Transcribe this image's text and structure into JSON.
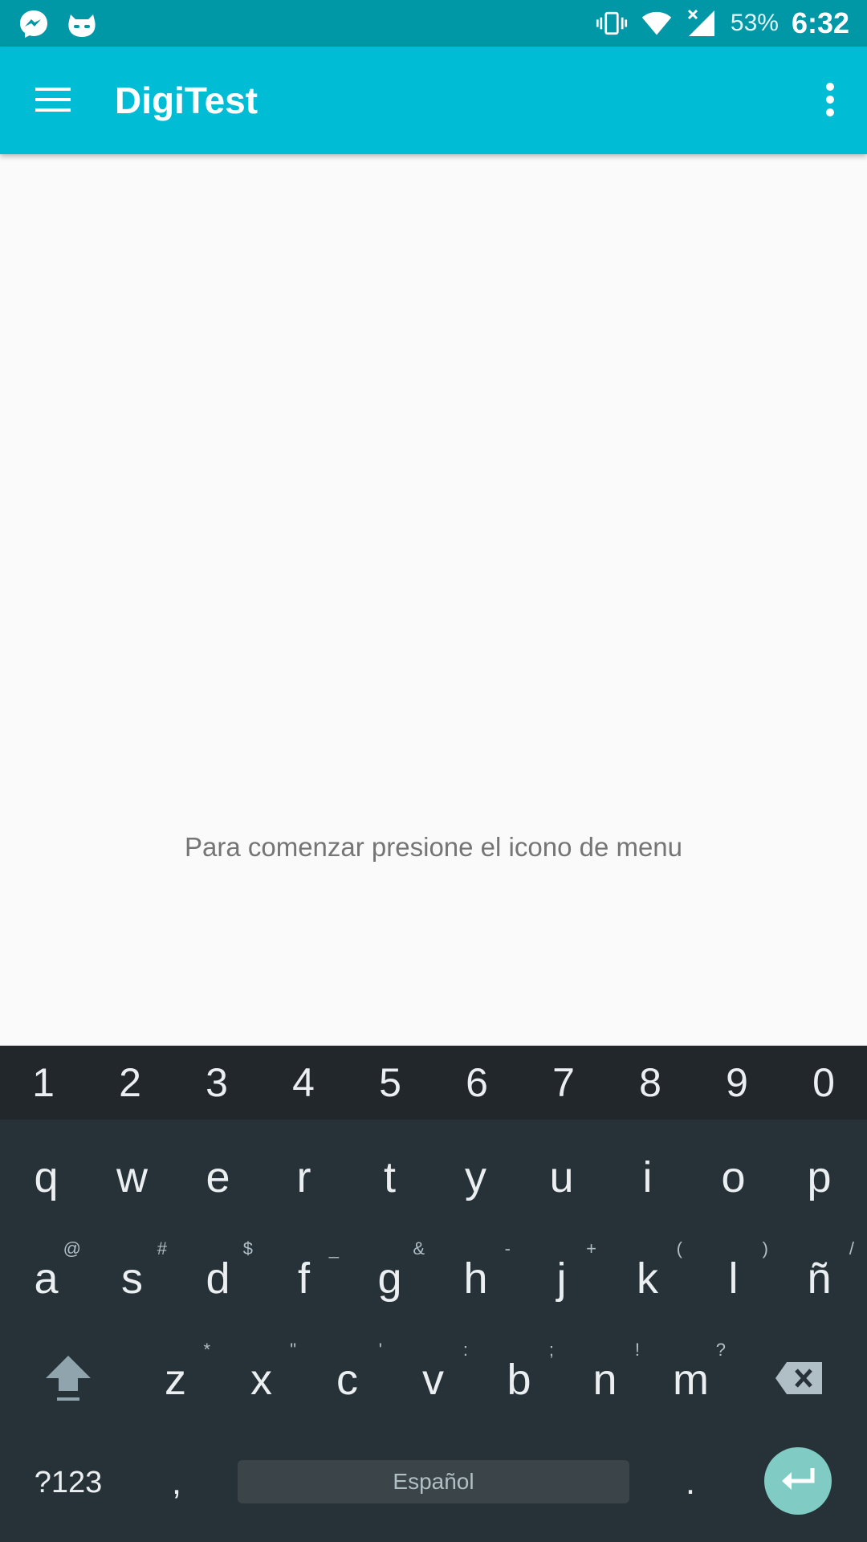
{
  "status_bar": {
    "battery": "53%",
    "time": "6:32",
    "icons": [
      "messenger-icon",
      "cyanogen-icon",
      "vibrate-icon",
      "wifi-icon",
      "signal-icon"
    ]
  },
  "app_bar": {
    "title": "DigiTest",
    "color": "#00BCD4"
  },
  "content": {
    "message": "Para comenzar presione el icono de menu"
  },
  "keyboard": {
    "number_row": [
      "1",
      "2",
      "3",
      "4",
      "5",
      "6",
      "7",
      "8",
      "9",
      "0"
    ],
    "row1": [
      {
        "key": "q"
      },
      {
        "key": "w"
      },
      {
        "key": "e"
      },
      {
        "key": "r"
      },
      {
        "key": "t"
      },
      {
        "key": "y"
      },
      {
        "key": "u"
      },
      {
        "key": "i"
      },
      {
        "key": "o"
      },
      {
        "key": "p"
      }
    ],
    "row2": [
      {
        "key": "a",
        "hint": "@"
      },
      {
        "key": "s",
        "hint": "#"
      },
      {
        "key": "d",
        "hint": "$"
      },
      {
        "key": "f",
        "hint": "_"
      },
      {
        "key": "g",
        "hint": "&"
      },
      {
        "key": "h",
        "hint": "-"
      },
      {
        "key": "j",
        "hint": "+"
      },
      {
        "key": "k",
        "hint": "("
      },
      {
        "key": "l",
        "hint": ")"
      },
      {
        "key": "ñ",
        "hint": "/"
      }
    ],
    "row3": [
      {
        "key": "z",
        "hint": "*"
      },
      {
        "key": "x",
        "hint": "\""
      },
      {
        "key": "c",
        "hint": "'"
      },
      {
        "key": "v",
        "hint": ":"
      },
      {
        "key": "b",
        "hint": ";"
      },
      {
        "key": "n",
        "hint": "!"
      },
      {
        "key": "m",
        "hint": "?"
      }
    ],
    "symbols_label": "?123",
    "comma": ",",
    "space_label": "Español",
    "period": ".",
    "enter_color": "#80CBC4"
  }
}
